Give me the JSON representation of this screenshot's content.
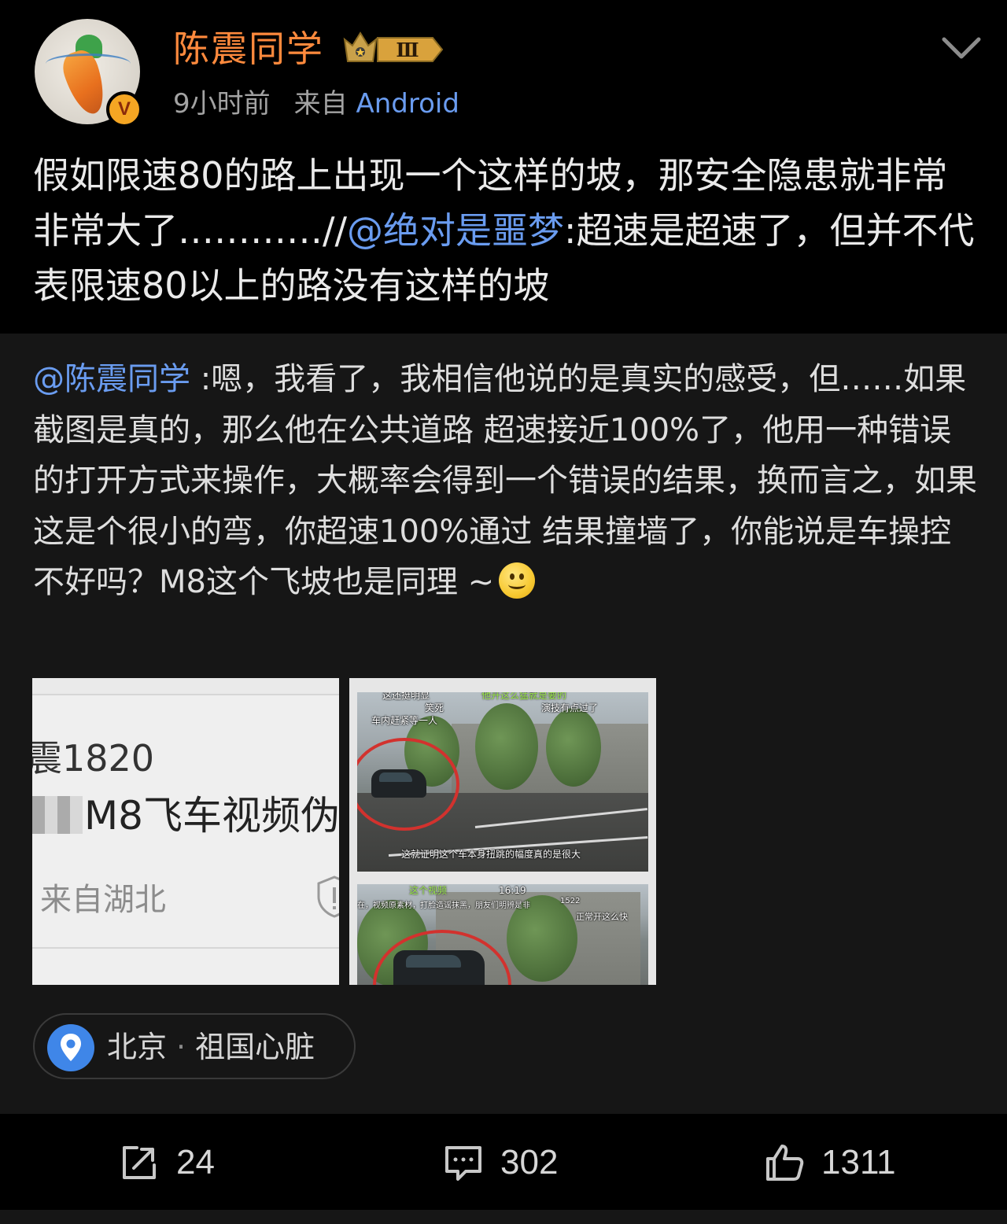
{
  "header": {
    "username": "陈震同学",
    "vip_level": "Ⅲ",
    "verify_mark": "V",
    "time": "9小时前",
    "source_prefix": "来自",
    "source": "Android"
  },
  "post": {
    "text_before": "假如限速80的路上出现一个这样的坡，那安全隐患就非常非常大了…………//",
    "mention": "@绝对是噩梦",
    "text_after": ":超速是超速了，但并不代表限速80以上的路没有这样的坡"
  },
  "repost": {
    "mention": "@陈震同学",
    "text": " :嗯，我看了，我相信他说的是真实的感受，但……如果截图是真的，那么他在公共道路 超速接近100%了，他用一种错误的打开方式来操作，大概率会得到一个错误的结果，换而言之，如果这是个很小的弯，你超速100%通过 结果撞墙了，你能说是车操控不好吗？M8这个飞坡也是同理 ~"
  },
  "images": {
    "image1": {
      "number": "震1820",
      "title": "M8飞车视频伪",
      "location": "来自湖北"
    },
    "image2": {
      "frame1_captions": {
        "top_left": "这还挺明显",
        "top_green": "他开这么猛就是要的",
        "laugh": "笑死",
        "right": "演技有点过了",
        "car_text": "车内赶紧等一人",
        "subtitle": "这就证明这个车本身扭跳的幅度真的是很大"
      },
      "frame2_captions": {
        "timestamp": "16:19",
        "top_green": "这个视频",
        "top_left": "在，视频原素材，打脸造谣抹黑，朋友们明辨是非",
        "like_count": "1522",
        "right": "正常开这么快"
      }
    }
  },
  "location": {
    "city": "北京",
    "separator": "·",
    "place": "祖国心脏"
  },
  "actions": {
    "share_count": "24",
    "comment_count": "302",
    "like_count": "1311"
  },
  "colors": {
    "background": "#000000",
    "repost_background": "#161616",
    "username": "#ff8a3d",
    "link": "#6a9cf0",
    "text": "#eaeaea",
    "meta": "#a3a3a3",
    "pin": "#3f86e8",
    "verify": "#f5a623"
  },
  "icons": {
    "chevron": "chevron-down-icon",
    "share": "share-icon",
    "comment": "comment-icon",
    "like": "thumbs-up-icon",
    "pin": "location-pin-icon",
    "emoji": "smile-emoji-icon"
  }
}
